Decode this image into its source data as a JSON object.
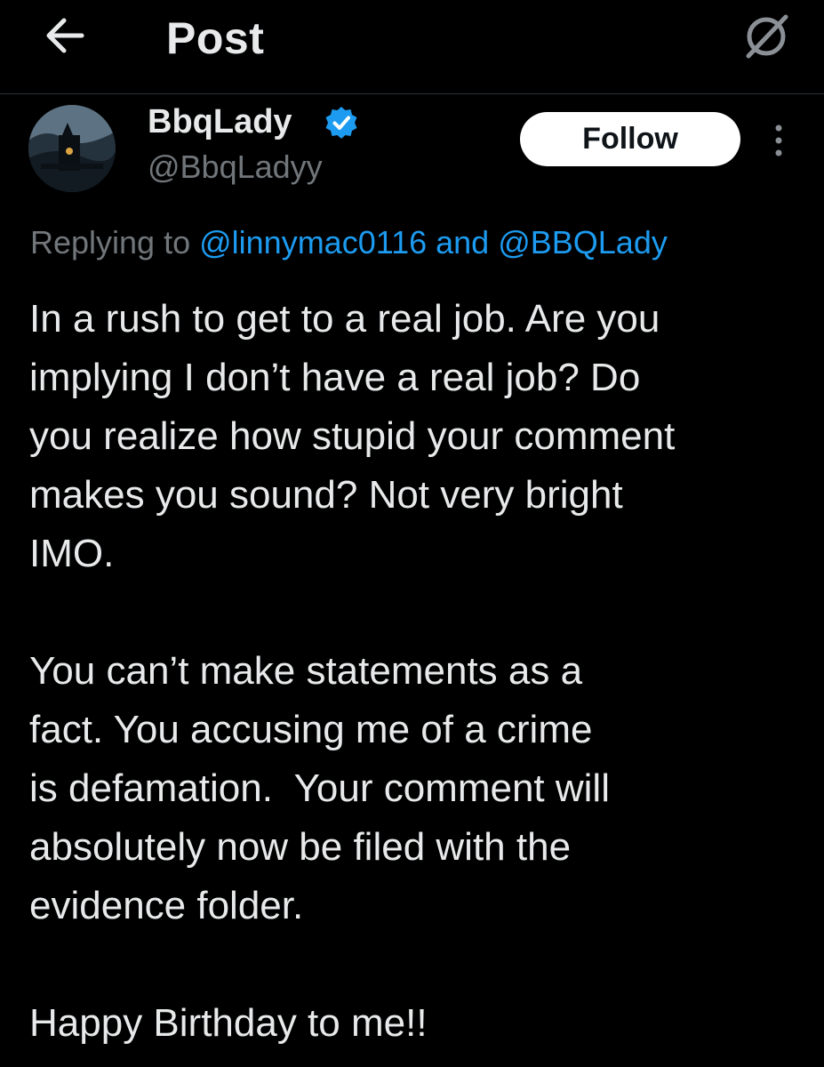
{
  "header": {
    "title": "Post",
    "back_icon": "arrow-left-icon",
    "grok_icon": "grok-icon"
  },
  "author": {
    "display_name": "BbqLady",
    "handle": "@BbqLadyy",
    "verified": true,
    "verified_color": "#1d9bf0",
    "avatar_icon": "avatar-image"
  },
  "actions": {
    "follow_label": "Follow",
    "more_icon": "more-vertical-icon"
  },
  "reply": {
    "prefix": "Replying to ",
    "mention_1": "@linnymac0116",
    "connector": " and ",
    "mention_2": "@BBQLady"
  },
  "post": {
    "paragraphs": [
      "In a rush to get to a real job. Are you\nimplying I don’t have a real job? Do\nyou realize how stupid your comment\nmakes you sound? Not very bright\nIMO.",
      "You can’t make statements as a\nfact. You accusing me of a crime\nis defamation.  Your comment will\nabsolutely now be filed with the\nevidence folder.",
      "Happy Birthday to me!!"
    ]
  },
  "colors": {
    "background": "#000000",
    "text": "#e7e9ea",
    "muted": "#71767b",
    "accent": "#1d9bf0",
    "divider": "#2f3336"
  }
}
